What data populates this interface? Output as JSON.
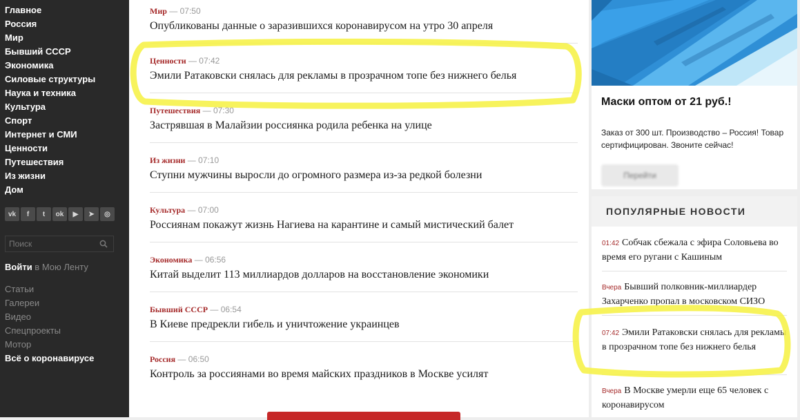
{
  "sidebar": {
    "nav": [
      "Главное",
      "Россия",
      "Мир",
      "Бывший СССР",
      "Экономика",
      "Силовые структуры",
      "Наука и техника",
      "Культура",
      "Спорт",
      "Интернет и СМИ",
      "Ценности",
      "Путешествия",
      "Из жизни",
      "Дом"
    ],
    "social": [
      {
        "icon": "vk-icon",
        "glyph": "vk"
      },
      {
        "icon": "facebook-icon",
        "glyph": "f"
      },
      {
        "icon": "twitter-icon",
        "glyph": "t"
      },
      {
        "icon": "odnoklassniki-icon",
        "glyph": "ok"
      },
      {
        "icon": "youtube-icon",
        "glyph": "▶"
      },
      {
        "icon": "telegram-icon",
        "glyph": "➤"
      },
      {
        "icon": "instagram-icon",
        "glyph": "◎"
      }
    ],
    "search_placeholder": "Поиск",
    "login": "Войти",
    "login_rest": " в Мою Ленту",
    "links": [
      "Статьи",
      "Галереи",
      "Видео",
      "Спецпроекты",
      "Мотор",
      "Всё о коронавирусе"
    ]
  },
  "feed": [
    {
      "rubric": "Мир",
      "time": "07:50",
      "title": "Опубликованы данные о заразившихся коронавирусом на утро 30 апреля"
    },
    {
      "rubric": "Ценности",
      "time": "07:42",
      "title": "Эмили Ратаковски снялась для рекламы в прозрачном топе без нижнего белья"
    },
    {
      "rubric": "Путешествия",
      "time": "07:30",
      "title": "Застрявшая в Малайзии россиянка родила ребенка на улице"
    },
    {
      "rubric": "Из жизни",
      "time": "07:10",
      "title": "Ступни мужчины выросли до огромного размера из-за редкой болезни"
    },
    {
      "rubric": "Культура",
      "time": "07:00",
      "title": "Россиянам покажут жизнь Нагиева на карантине и самый мистический балет"
    },
    {
      "rubric": "Экономика",
      "time": "06:56",
      "title": "Китай выделит 113 миллиардов долларов на восстановление экономики"
    },
    {
      "rubric": "Бывший СССР",
      "time": "06:54",
      "title": "В Киеве предрекли гибель и уничтожение украинцев"
    },
    {
      "rubric": "Россия",
      "time": "06:50",
      "title": "Контроль за россиянами во время майских праздников в Москве усилят"
    }
  ],
  "ad": {
    "title": "Маски оптом от 21 руб.!",
    "text": "Заказ от 300 шт. Производство – Россия! Товар сертифицирован. Звоните сейчас!",
    "button": "Перейти"
  },
  "popular": {
    "header": "ПОПУЛЯРНЫЕ НОВОСТИ",
    "items": [
      {
        "time": "01:42",
        "title": "Собчак сбежала с эфира Соловьева во время его ругани с Кашиным"
      },
      {
        "time": "Вчера",
        "title": "Бывший полковник-миллиардер Захарченко пропал в московском СИЗО"
      },
      {
        "time": "07:42",
        "title": "Эмили Ратаковски снялась для рекламы в прозрачном топе без нижнего белья"
      },
      {
        "time": "Вчера",
        "title": "В Москве умерли еще 65 человек с коронавирусом"
      }
    ]
  },
  "colors": {
    "rubric": "#a52a2a",
    "highlight": "#f6f24a",
    "sidebar_bg": "#292929",
    "load_more": "#c62828"
  }
}
